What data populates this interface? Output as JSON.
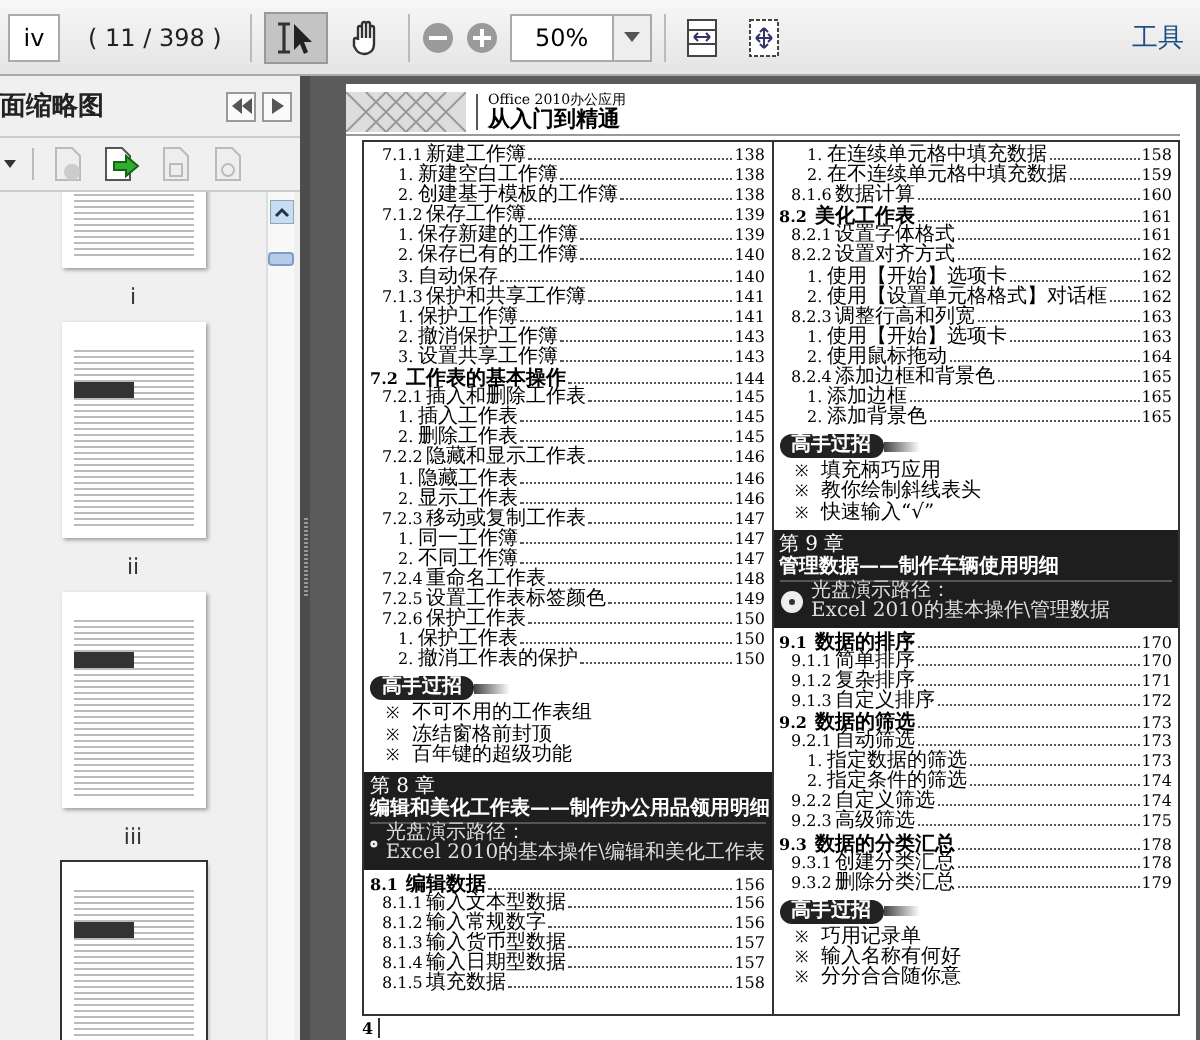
{
  "toolbar": {
    "page_field": "iv",
    "page_count": "( 11 / 398 )",
    "zoom": "50%",
    "tools_label": "工具"
  },
  "sidebar": {
    "title": "面缩略图",
    "thumbnails": [
      {
        "label": "i",
        "selected": false
      },
      {
        "label": "ii",
        "selected": false
      },
      {
        "label": "iii",
        "selected": false
      },
      {
        "selected": true
      }
    ]
  },
  "document": {
    "header": {
      "subtitle": "Office 2010办公应用",
      "title": "从入门到精通"
    },
    "columns": [
      [
        {
          "kind": "sub",
          "num": "7.1.1",
          "text": "新建工作簿",
          "page": "138"
        },
        {
          "kind": "item",
          "num": "1.",
          "text": "新建空白工作簿",
          "page": "138"
        },
        {
          "kind": "item",
          "num": "2.",
          "text": "创建基于模板的工作簿",
          "page": "138"
        },
        {
          "kind": "sub",
          "num": "7.1.2",
          "text": "保存工作簿",
          "page": "139"
        },
        {
          "kind": "item",
          "num": "1.",
          "text": "保存新建的工作簿",
          "page": "139"
        },
        {
          "kind": "item",
          "num": "2.",
          "text": "保存已有的工作簿",
          "page": "140"
        },
        {
          "kind": "item",
          "num": "3.",
          "text": "自动保存",
          "page": "140"
        },
        {
          "kind": "sub",
          "num": "7.1.3",
          "text": "保护和共享工作簿",
          "page": "141"
        },
        {
          "kind": "item",
          "num": "1.",
          "text": "保护工作簿",
          "page": "141"
        },
        {
          "kind": "item",
          "num": "2.",
          "text": "撤消保护工作簿",
          "page": "143"
        },
        {
          "kind": "item",
          "num": "3.",
          "text": "设置共享工作簿",
          "page": "143"
        },
        {
          "kind": "section",
          "num": "7.2",
          "text": "工作表的基本操作",
          "page": "144"
        },
        {
          "kind": "sub",
          "num": "7.2.1",
          "text": "插入和删除工作表",
          "page": "145"
        },
        {
          "kind": "item",
          "num": "1.",
          "text": "插入工作表",
          "page": "145"
        },
        {
          "kind": "item",
          "num": "2.",
          "text": "删除工作表",
          "page": "145"
        },
        {
          "kind": "sub",
          "num": "7.2.2",
          "text": "隐藏和显示工作表",
          "page": "146"
        },
        {
          "kind": "item",
          "num": "1.",
          "text": "隐藏工作表",
          "page": "146"
        },
        {
          "kind": "item",
          "num": "2.",
          "text": "显示工作表",
          "page": "146"
        },
        {
          "kind": "sub",
          "num": "7.2.3",
          "text": "移动或复制工作表",
          "page": "147"
        },
        {
          "kind": "item",
          "num": "1.",
          "text": "同一工作簿",
          "page": "147"
        },
        {
          "kind": "item",
          "num": "2.",
          "text": "不同工作簿",
          "page": "147"
        },
        {
          "kind": "sub",
          "num": "7.2.4",
          "text": "重命名工作表",
          "page": "148"
        },
        {
          "kind": "sub",
          "num": "7.2.5",
          "text": "设置工作表标签颜色",
          "page": "149"
        },
        {
          "kind": "sub",
          "num": "7.2.6",
          "text": "保护工作表",
          "page": "150"
        },
        {
          "kind": "item",
          "num": "1.",
          "text": "保护工作表",
          "page": "150"
        },
        {
          "kind": "item",
          "num": "2.",
          "text": "撤消工作表的保护",
          "page": "150"
        },
        {
          "kind": "badge",
          "text": "高手过招"
        },
        {
          "kind": "tip",
          "bullet": "※",
          "text": "不可不用的工作表组"
        },
        {
          "kind": "tip",
          "bullet": "※",
          "text": "冻结窗格前封顶"
        },
        {
          "kind": "tip",
          "bullet": "※",
          "text": "百年键的超级功能"
        },
        {
          "kind": "chapter",
          "label": "第 8 章",
          "title": "编辑和美化工作表——制作办公用品领用明细",
          "path_label": "光盘演示路径：",
          "path": "Excel 2010的基本操作\\编辑和美化工作表"
        },
        {
          "kind": "section",
          "num": "8.1",
          "text": "编辑数据",
          "page": "156"
        },
        {
          "kind": "sub",
          "num": "8.1.1",
          "text": "输入文本型数据",
          "page": "156"
        },
        {
          "kind": "sub",
          "num": "8.1.2",
          "text": "输入常规数字",
          "page": "156"
        },
        {
          "kind": "sub",
          "num": "8.1.3",
          "text": "输入货币型数据",
          "page": "157"
        },
        {
          "kind": "sub",
          "num": "8.1.4",
          "text": "输入日期型数据",
          "page": "157"
        },
        {
          "kind": "sub",
          "num": "8.1.5",
          "text": "填充数据",
          "page": "158"
        }
      ],
      [
        {
          "kind": "item",
          "num": "1.",
          "text": "在连续单元格中填充数据",
          "page": "158"
        },
        {
          "kind": "item",
          "num": "2.",
          "text": "在不连续单元格中填充数据",
          "page": "159"
        },
        {
          "kind": "sub",
          "num": "8.1.6",
          "text": "数据计算",
          "page": "160"
        },
        {
          "kind": "section",
          "num": "8.2",
          "text": "美化工作表",
          "page": "161"
        },
        {
          "kind": "sub",
          "num": "8.2.1",
          "text": "设置字体格式",
          "page": "161"
        },
        {
          "kind": "sub",
          "num": "8.2.2",
          "text": "设置对齐方式",
          "page": "162"
        },
        {
          "kind": "item",
          "num": "1.",
          "text": "使用【开始】选项卡",
          "page": "162"
        },
        {
          "kind": "item",
          "num": "2.",
          "text": "使用【设置单元格格式】对话框",
          "page": "162"
        },
        {
          "kind": "sub",
          "num": "8.2.3",
          "text": "调整行高和列宽",
          "page": "163"
        },
        {
          "kind": "item",
          "num": "1.",
          "text": "使用【开始】选项卡",
          "page": "163"
        },
        {
          "kind": "item",
          "num": "2.",
          "text": "使用鼠标拖动",
          "page": "164"
        },
        {
          "kind": "sub",
          "num": "8.2.4",
          "text": "添加边框和背景色",
          "page": "165"
        },
        {
          "kind": "item",
          "num": "1.",
          "text": "添加边框",
          "page": "165"
        },
        {
          "kind": "item",
          "num": "2.",
          "text": "添加背景色",
          "page": "165"
        },
        {
          "kind": "badge",
          "text": "高手过招"
        },
        {
          "kind": "tip",
          "bullet": "※",
          "text": "填充柄巧应用"
        },
        {
          "kind": "tip",
          "bullet": "※",
          "text": "教你绘制斜线表头"
        },
        {
          "kind": "tip",
          "bullet": "※",
          "text": "快速输入“√”"
        },
        {
          "kind": "chapter",
          "label": "第 9 章",
          "title": "管理数据——制作车辆使用明细",
          "path_label": "光盘演示路径：",
          "path": "Excel 2010的基本操作\\管理数据"
        },
        {
          "kind": "section",
          "num": "9.1",
          "text": "数据的排序",
          "page": "170"
        },
        {
          "kind": "sub",
          "num": "9.1.1",
          "text": "简单排序",
          "page": "170"
        },
        {
          "kind": "sub",
          "num": "9.1.2",
          "text": "复杂排序",
          "page": "171"
        },
        {
          "kind": "sub",
          "num": "9.1.3",
          "text": "自定义排序",
          "page": "172"
        },
        {
          "kind": "section",
          "num": "9.2",
          "text": "数据的筛选",
          "page": "173"
        },
        {
          "kind": "sub",
          "num": "9.2.1",
          "text": "自动筛选",
          "page": "173"
        },
        {
          "kind": "item",
          "num": "1.",
          "text": "指定数据的筛选",
          "page": "173"
        },
        {
          "kind": "item",
          "num": "2.",
          "text": "指定条件的筛选",
          "page": "174"
        },
        {
          "kind": "sub",
          "num": "9.2.2",
          "text": "自定义筛选",
          "page": "174"
        },
        {
          "kind": "sub",
          "num": "9.2.3",
          "text": "高级筛选",
          "page": "175"
        },
        {
          "kind": "section",
          "num": "9.3",
          "text": "数据的分类汇总",
          "page": "178"
        },
        {
          "kind": "sub",
          "num": "9.3.1",
          "text": "创建分类汇总",
          "page": "178"
        },
        {
          "kind": "sub",
          "num": "9.3.2",
          "text": "删除分类汇总",
          "page": "179"
        },
        {
          "kind": "badge",
          "text": "高手过招"
        },
        {
          "kind": "tip",
          "bullet": "※",
          "text": "巧用记录单"
        },
        {
          "kind": "tip",
          "bullet": "※",
          "text": "输入名称有何好"
        },
        {
          "kind": "tip",
          "bullet": "※",
          "text": "分分合合随你意"
        }
      ]
    ],
    "page_number": "4"
  }
}
